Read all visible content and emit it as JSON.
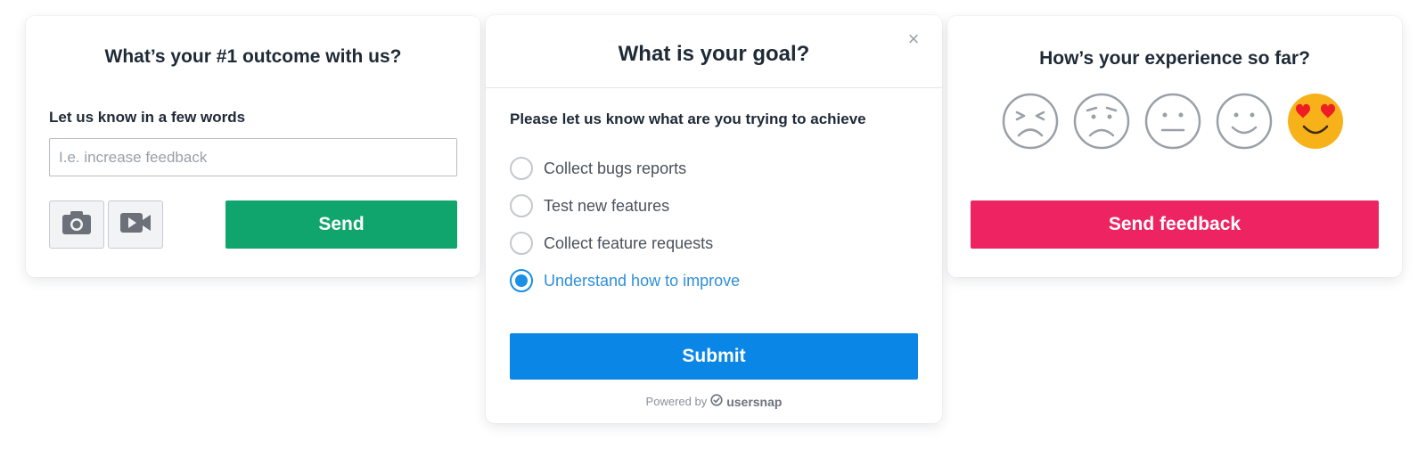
{
  "outcome_card": {
    "title": "What’s your #1 outcome with us?",
    "input_label": "Let us know in a few words",
    "input_placeholder": "I.e. increase feedback",
    "input_value": "",
    "send_label": "Send",
    "camera_icon": "camera-icon",
    "video_icon": "video-camera-icon",
    "accent_color": "#10a56c"
  },
  "goal_card": {
    "title": "What is your goal?",
    "close_glyph": "×",
    "subtitle": "Please let us know what are you trying to achieve",
    "options": [
      {
        "label": "Collect bugs reports",
        "selected": false
      },
      {
        "label": "Test new features",
        "selected": false
      },
      {
        "label": "Collect feature requests",
        "selected": false
      },
      {
        "label": "Understand how to improve",
        "selected": true
      }
    ],
    "submit_label": "Submit",
    "powered_by": "Powered by",
    "brand": "usersnap",
    "accent_color": "#0a87e6"
  },
  "experience_card": {
    "title": "How’s your experience so far?",
    "ratings": [
      "frustrated-emoji-icon",
      "sad-emoji-icon",
      "neutral-emoji-icon",
      "smile-emoji-icon",
      "heart-eyes-emoji-icon"
    ],
    "selected_rating": 5,
    "button_label": "Send feedback",
    "accent_color": "#ee2462"
  }
}
